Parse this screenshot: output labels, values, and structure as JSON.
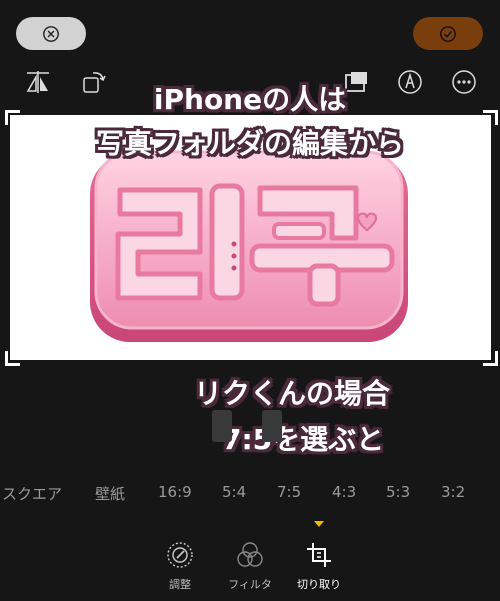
{
  "captions": {
    "line1": "iPhoneの人は",
    "line2": "写真フォルダの編集から",
    "line3": "リクくんの場合",
    "line4": "7:5を選ぶと"
  },
  "ratios": [
    "スクエア",
    "壁紙",
    "16:9",
    "5:4",
    "7:5",
    "4:3",
    "5:3",
    "3:2"
  ],
  "tabs": {
    "adjust": "調整",
    "filter": "フィルタ",
    "crop": "切り取り"
  },
  "colors": {
    "background": "#161616",
    "done_button": "#7a3d0c",
    "indicator": "#f2b800",
    "logo_pink": "#f3a9c4"
  },
  "icons": [
    "cancel-icon",
    "done-icon",
    "flip-icon",
    "rotate-icon",
    "aspect-icon",
    "markup-icon",
    "more-icon",
    "adjust-icon",
    "filter-icon",
    "crop-icon"
  ]
}
